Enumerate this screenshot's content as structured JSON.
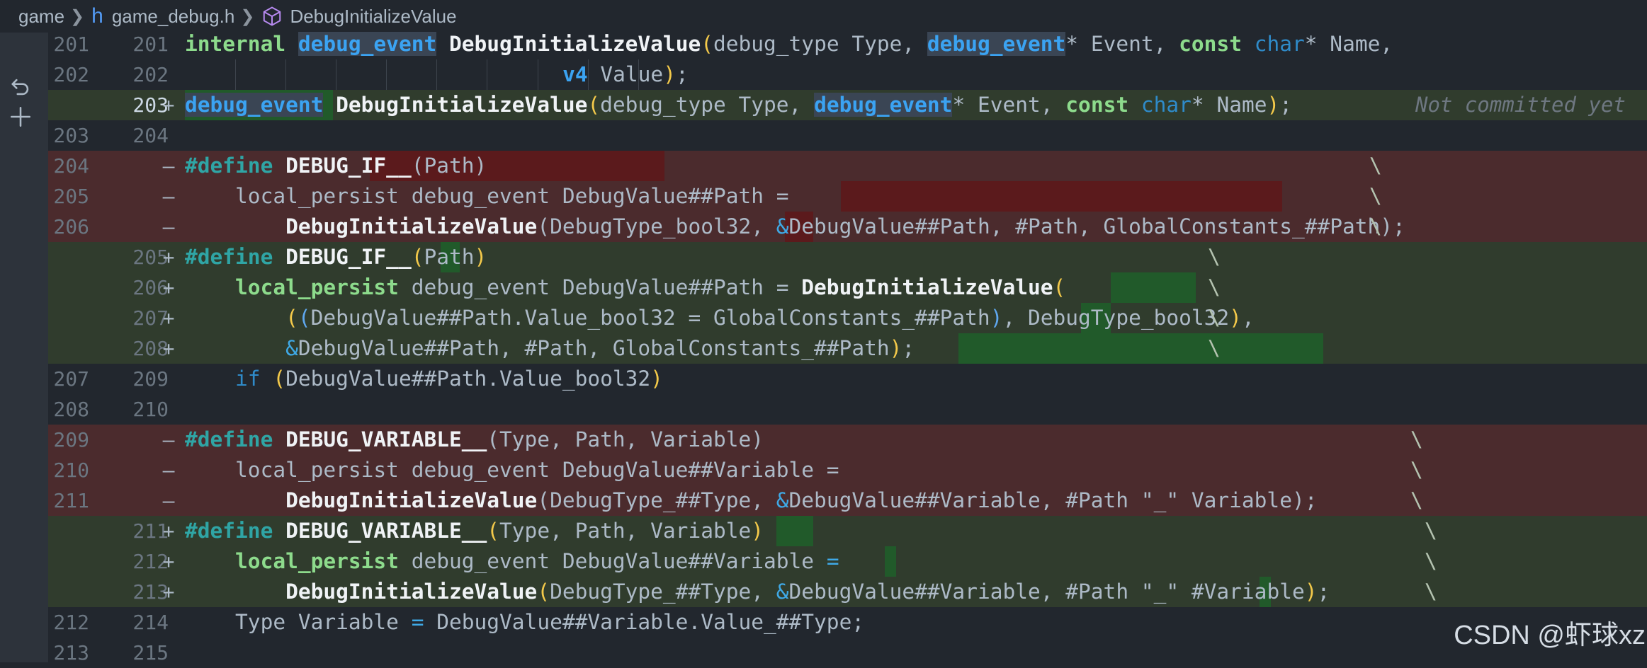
{
  "breadcrumb": {
    "folder": "game",
    "file_icon": "h",
    "file": "game_debug.h",
    "symbol": "DebugInitializeValue"
  },
  "side_actions": [
    "revert-icon",
    "stage-icon"
  ],
  "blame": {
    "text": "Not committed yet"
  },
  "watermark": "CSDN @虾球xz",
  "lines": [
    {
      "old": "201",
      "new": "201",
      "marker": "",
      "kind": "context"
    },
    {
      "old": "202",
      "new": "202",
      "marker": "",
      "kind": "context"
    },
    {
      "old": "",
      "new": "203",
      "marker": "+",
      "kind": "add"
    },
    {
      "old": "203",
      "new": "204",
      "marker": "",
      "kind": "context"
    },
    {
      "old": "204",
      "new": "",
      "marker": "—",
      "kind": "del"
    },
    {
      "old": "205",
      "new": "",
      "marker": "—",
      "kind": "del"
    },
    {
      "old": "206",
      "new": "",
      "marker": "—",
      "kind": "del"
    },
    {
      "old": "",
      "new": "205",
      "marker": "+",
      "kind": "add"
    },
    {
      "old": "",
      "new": "206",
      "marker": "+",
      "kind": "add"
    },
    {
      "old": "",
      "new": "207",
      "marker": "+",
      "kind": "add"
    },
    {
      "old": "",
      "new": "208",
      "marker": "+",
      "kind": "add"
    },
    {
      "old": "207",
      "new": "209",
      "marker": "",
      "kind": "context"
    },
    {
      "old": "208",
      "new": "210",
      "marker": "",
      "kind": "context"
    },
    {
      "old": "209",
      "new": "",
      "marker": "—",
      "kind": "del"
    },
    {
      "old": "210",
      "new": "",
      "marker": "—",
      "kind": "del"
    },
    {
      "old": "211",
      "new": "",
      "marker": "—",
      "kind": "del"
    },
    {
      "old": "",
      "new": "211",
      "marker": "+",
      "kind": "add"
    },
    {
      "old": "",
      "new": "212",
      "marker": "+",
      "kind": "add"
    },
    {
      "old": "",
      "new": "213",
      "marker": "+",
      "kind": "add"
    },
    {
      "old": "212",
      "new": "214",
      "marker": "",
      "kind": "context"
    },
    {
      "old": "213",
      "new": "215",
      "marker": "",
      "kind": "context"
    }
  ],
  "code": [
    [
      [
        "internal ",
        "kw"
      ],
      [
        "debug_event",
        "ty"
      ],
      [
        " ",
        ""
      ],
      [
        "DebugInitializeValue",
        "fn"
      ],
      [
        "(",
        "br"
      ],
      [
        "debug_type Type, ",
        ""
      ],
      [
        "debug_event",
        "ty"
      ],
      [
        "* Event, ",
        ""
      ],
      [
        "const ",
        "kw"
      ],
      [
        "char",
        "ty-n"
      ],
      [
        "* Name,",
        ""
      ]
    ],
    [
      [
        "v4 ",
        "ty"
      ],
      [
        "Value",
        ""
      ],
      [
        ")",
        "br"
      ],
      [
        ";",
        ""
      ]
    ],
    [
      [
        "debug_event",
        "ty"
      ],
      [
        " ",
        ""
      ],
      [
        "DebugInitializeValue",
        "fn"
      ],
      [
        "(",
        "br"
      ],
      [
        "debug_type Type, ",
        ""
      ],
      [
        "debug_event",
        "ty"
      ],
      [
        "* Event, ",
        ""
      ],
      [
        "const ",
        "kw"
      ],
      [
        "char",
        "ty-n"
      ],
      [
        "* Name",
        ""
      ],
      [
        ")",
        "br"
      ],
      [
        ";",
        ""
      ]
    ],
    [],
    [
      [
        "#define ",
        "pre"
      ],
      [
        "DEBUG_IF__",
        "def"
      ],
      [
        "(Path)",
        ""
      ]
    ],
    [
      [
        "    local_persist debug_event DebugValue##Path =",
        ""
      ]
    ],
    [
      [
        "        ",
        ""
      ],
      [
        "DebugInitializeValue",
        "fn"
      ],
      [
        "(DebugType_bool32, ",
        ""
      ],
      [
        "&",
        "op"
      ],
      [
        "DebugValue##Path, #Path, GlobalConstants_##Path);",
        ""
      ]
    ],
    [
      [
        "#define ",
        "pre"
      ],
      [
        "DEBUG_IF__",
        "def"
      ],
      [
        "(",
        "br"
      ],
      [
        "Path",
        ""
      ],
      [
        ")",
        "br"
      ]
    ],
    [
      [
        "    ",
        ""
      ],
      [
        "local_persist ",
        "kw"
      ],
      [
        "debug_event DebugValue##Path = ",
        ""
      ],
      [
        "DebugInitializeValue",
        "fn"
      ],
      [
        "(",
        "br"
      ]
    ],
    [
      [
        "        ",
        ""
      ],
      [
        "(",
        "br"
      ],
      [
        "(",
        "br2"
      ],
      [
        "DebugValue##Path.Value_bool32 = GlobalConstants_##Path",
        ""
      ],
      [
        ")",
        "br2"
      ],
      [
        ", DebugType_bool32",
        ""
      ],
      [
        ")",
        "br"
      ],
      [
        ",",
        ""
      ]
    ],
    [
      [
        "        ",
        ""
      ],
      [
        "&",
        "op"
      ],
      [
        "DebugValue##Path, #Path, GlobalConstants_##Path",
        ""
      ],
      [
        ")",
        "br"
      ],
      [
        ";",
        ""
      ]
    ],
    [
      [
        "    ",
        ""
      ],
      [
        "if ",
        "ty-n"
      ],
      [
        "(",
        "br"
      ],
      [
        "DebugValue##Path.Value_bool32",
        ""
      ],
      [
        ")",
        "br"
      ]
    ],
    [],
    [
      [
        "#define ",
        "pre"
      ],
      [
        "DEBUG_VARIABLE__",
        "def"
      ],
      [
        "(Type, Path, Variable)",
        ""
      ]
    ],
    [
      [
        "    local_persist debug_event DebugValue##Variable = ",
        ""
      ]
    ],
    [
      [
        "        ",
        ""
      ],
      [
        "DebugInitializeValue",
        "fn"
      ],
      [
        "(DebugType_##Type, ",
        ""
      ],
      [
        "&",
        "op"
      ],
      [
        "DebugValue##Variable, #Path \"_\" Variable);",
        ""
      ]
    ],
    [
      [
        "#define ",
        "pre"
      ],
      [
        "DEBUG_VARIABLE__",
        "def"
      ],
      [
        "(",
        "br"
      ],
      [
        "Type, Path, Variable",
        ""
      ],
      [
        ")",
        "br"
      ]
    ],
    [
      [
        "    ",
        ""
      ],
      [
        "local_persist ",
        "kw"
      ],
      [
        "debug_event DebugValue##Variable ",
        ""
      ],
      [
        "=",
        "op"
      ]
    ],
    [
      [
        "        ",
        ""
      ],
      [
        "DebugInitializeValue",
        "fn"
      ],
      [
        "(",
        "br"
      ],
      [
        "DebugType_##Type, ",
        ""
      ],
      [
        "&",
        "op"
      ],
      [
        "DebugValue##Variable, #Path \"_\" #Variable",
        ""
      ],
      [
        ")",
        "br"
      ],
      [
        "; ",
        ""
      ]
    ],
    [
      [
        "    Type Variable ",
        ""
      ],
      [
        "=",
        "op"
      ],
      [
        " DebugValue##Variable.Value_##Type;",
        ""
      ]
    ],
    []
  ],
  "continuations": [
    {
      "row": 4,
      "text": "\\"
    },
    {
      "row": 5,
      "text": "\\"
    },
    {
      "row": 6,
      "text": "\\"
    },
    {
      "row": 7,
      "text": "\\"
    },
    {
      "row": 8,
      "text": "\\"
    },
    {
      "row": 9,
      "text": "\\"
    },
    {
      "row": 10,
      "text": "\\"
    },
    {
      "row": 13,
      "text": "\\"
    },
    {
      "row": 14,
      "text": "\\"
    },
    {
      "row": 15,
      "text": "\\"
    },
    {
      "row": 16,
      "text": "\\"
    },
    {
      "row": 17,
      "text": "\\"
    },
    {
      "row": 18,
      "text": "\\"
    }
  ]
}
